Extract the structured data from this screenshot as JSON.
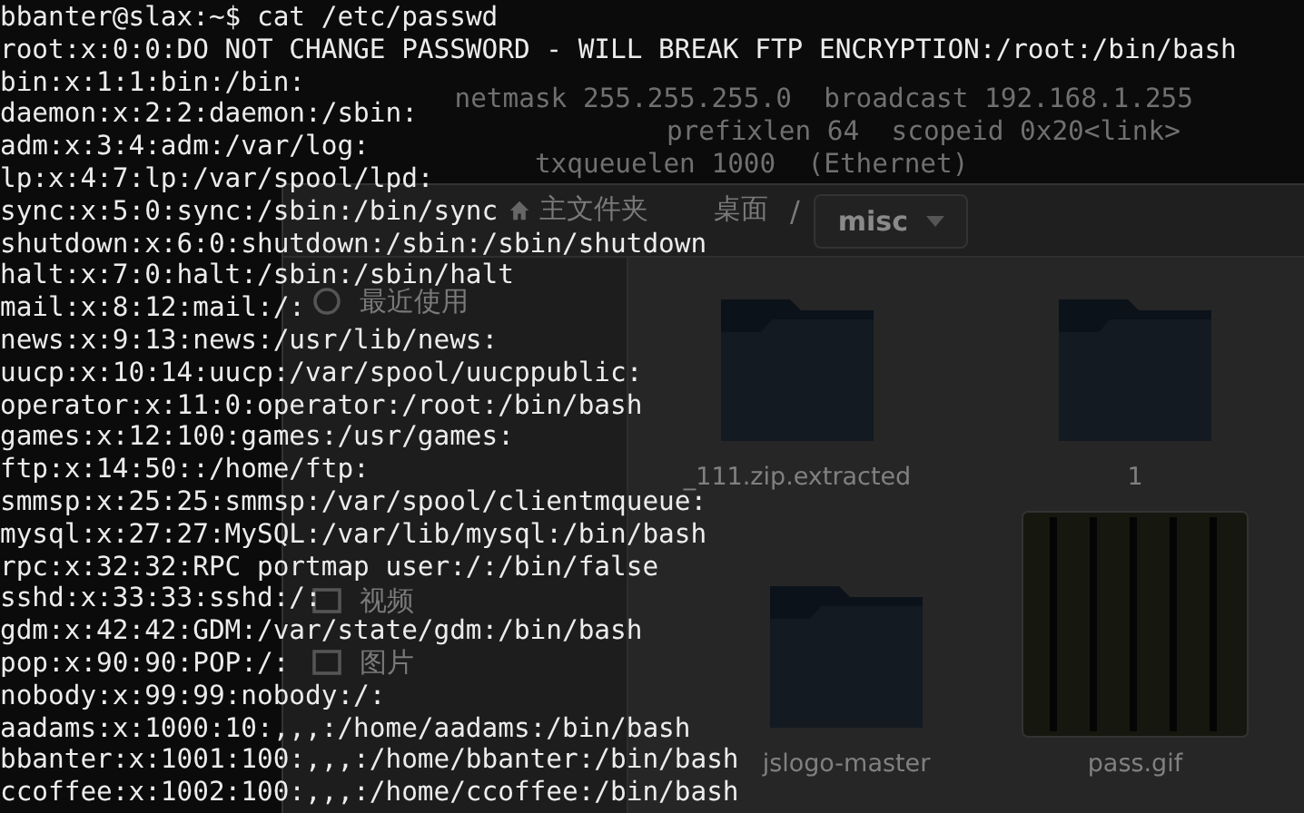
{
  "back_terminal": {
    "lines": [
      {
        "text": "netmask 255.255.255.0  broadcast 192.168.1.255"
      },
      {
        "text": "prefixlen 64  scopeid 0x20<link>"
      },
      {
        "text": "txqueuelen 1000  (Ethernet)"
      }
    ]
  },
  "file_manager": {
    "breadcrumb": [
      {
        "label": "主文件夹",
        "kind": "home"
      },
      {
        "label": "桌面",
        "kind": "crumb"
      },
      {
        "label": "misc",
        "kind": "current"
      }
    ],
    "path_separator": "/",
    "sidebar": [
      {
        "label": "最近使用",
        "kind": "recent"
      },
      {
        "label": "视频",
        "kind": "video"
      },
      {
        "label": "图片",
        "kind": "pictures"
      }
    ],
    "files": [
      {
        "name": "_111.zip.extracted",
        "kind": "folder"
      },
      {
        "name": "1",
        "kind": "folder"
      },
      {
        "name": "jslogo-master",
        "kind": "folder"
      },
      {
        "name": "pass.gif",
        "kind": "image"
      }
    ]
  },
  "terminal": {
    "prompt": "bbanter@slax:~$",
    "command": "cat /etc/passwd",
    "output": [
      "root:x:0:0:DO NOT CHANGE PASSWORD - WILL BREAK FTP ENCRYPTION:/root:/bin/bash",
      "bin:x:1:1:bin:/bin:",
      "daemon:x:2:2:daemon:/sbin:",
      "adm:x:3:4:adm:/var/log:",
      "lp:x:4:7:lp:/var/spool/lpd:",
      "sync:x:5:0:sync:/sbin:/bin/sync",
      "shutdown:x:6:0:shutdown:/sbin:/sbin/shutdown",
      "halt:x:7:0:halt:/sbin:/sbin/halt",
      "mail:x:8:12:mail:/:",
      "news:x:9:13:news:/usr/lib/news:",
      "uucp:x:10:14:uucp:/var/spool/uucppublic:",
      "operator:x:11:0:operator:/root:/bin/bash",
      "games:x:12:100:games:/usr/games:",
      "ftp:x:14:50::/home/ftp:",
      "smmsp:x:25:25:smmsp:/var/spool/clientmqueue:",
      "mysql:x:27:27:MySQL:/var/lib/mysql:/bin/bash",
      "rpc:x:32:32:RPC portmap user:/:/bin/false",
      "sshd:x:33:33:sshd:/:",
      "gdm:x:42:42:GDM:/var/state/gdm:/bin/bash",
      "pop:x:90:90:POP:/:",
      "nobody:x:99:99:nobody:/:",
      "aadams:x:1000:10:,,,:/home/aadams:/bin/bash",
      "bbanter:x:1001:100:,,,:/home/bbanter:/bin/bash",
      "ccoffee:x:1002:100:,,,:/home/ccoffee:/bin/bash"
    ]
  }
}
